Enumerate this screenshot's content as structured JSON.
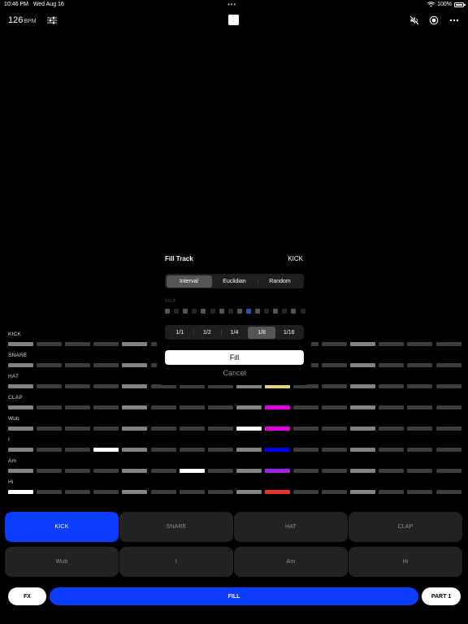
{
  "status_bar": {
    "time": "10:46 PM",
    "date": "Wed Aug 16",
    "dots": "•••",
    "battery": "100%"
  },
  "toolbar": {
    "bpm_value": "126",
    "bpm_unit": "BPM",
    "icons": [
      "sliders-icon",
      "stop-icon",
      "speaker-muted-icon",
      "record-icon",
      "more-icon"
    ]
  },
  "colors": {
    "accent": "#0b3cff",
    "step_off": "#3d3d3d",
    "step_on": "#838383",
    "step_white": "#ffffff",
    "yellow": "#e6d27a",
    "magenta": "#e600e6",
    "blue": "#0000ee",
    "purple": "#a020f0",
    "red": "#e8342c"
  },
  "grid": {
    "tracks": [
      {
        "label": "KICK",
        "steps": [
          "on",
          "off",
          "off",
          "off",
          "on",
          "off",
          "off",
          "off",
          "on",
          "off",
          "off",
          "off",
          "on",
          "off",
          "off",
          "off"
        ]
      },
      {
        "label": "SNARE",
        "steps": [
          "on",
          "off",
          "off",
          "off",
          "on",
          "off",
          "off",
          "off",
          "on",
          "off",
          "off",
          "off",
          "on",
          "off",
          "off",
          "off"
        ]
      },
      {
        "label": "HAT",
        "steps": [
          "on",
          "off",
          "off",
          "off",
          "on",
          "off",
          "off",
          "off",
          "on",
          "yellow",
          "off",
          "off",
          "on",
          "off",
          "off",
          "off"
        ]
      },
      {
        "label": "CLAP",
        "steps": [
          "on",
          "off",
          "off",
          "off",
          "on",
          "off",
          "off",
          "off",
          "on",
          "magenta",
          "off",
          "off",
          "on",
          "off",
          "off",
          "off"
        ]
      },
      {
        "label": "Wub",
        "steps": [
          "on",
          "off",
          "off",
          "off",
          "on",
          "off",
          "off",
          "off",
          "white",
          "magenta",
          "off",
          "off",
          "on",
          "off",
          "off",
          "off"
        ]
      },
      {
        "label": "I",
        "steps": [
          "on",
          "off",
          "off",
          "white",
          "on",
          "off",
          "off",
          "off",
          "on",
          "blue",
          "off",
          "off",
          "on",
          "off",
          "off",
          "off"
        ]
      },
      {
        "label": "Am",
        "steps": [
          "on",
          "off",
          "off",
          "off",
          "on",
          "off",
          "white",
          "off",
          "on",
          "purple",
          "off",
          "off",
          "on",
          "off",
          "off",
          "off"
        ]
      },
      {
        "label": "Hi",
        "steps": [
          "white",
          "off",
          "off",
          "off",
          "on",
          "off",
          "off",
          "off",
          "on",
          "red",
          "off",
          "off",
          "on",
          "off",
          "off",
          "off"
        ]
      }
    ]
  },
  "fill_modal": {
    "title": "Fill Track",
    "track": "KICK",
    "modes": [
      "Interval",
      "Euclidian",
      "Random"
    ],
    "selected_mode": 0,
    "preview_label": "KICK",
    "preview_steps": [
      "mid",
      "dark",
      "mid",
      "dark",
      "mid",
      "dark",
      "mid",
      "dark",
      "mid",
      "blue",
      "mid",
      "dark",
      "mid",
      "dark",
      "mid",
      "dark"
    ],
    "divisions": [
      "1/1",
      "1/2",
      "1/4",
      "1/8",
      "1/16"
    ],
    "selected_division": 3,
    "fill_label": "Fill",
    "cancel_label": "Cancel"
  },
  "pads": {
    "row1": [
      "KICK",
      "SNARE",
      "HAT",
      "CLAP"
    ],
    "row2": [
      "Wub",
      "I",
      "Am",
      "Hi"
    ],
    "active": "KICK"
  },
  "bottom_bar": {
    "fx_label": "FX",
    "fill_label": "FILL",
    "part_label": "PART 1"
  }
}
